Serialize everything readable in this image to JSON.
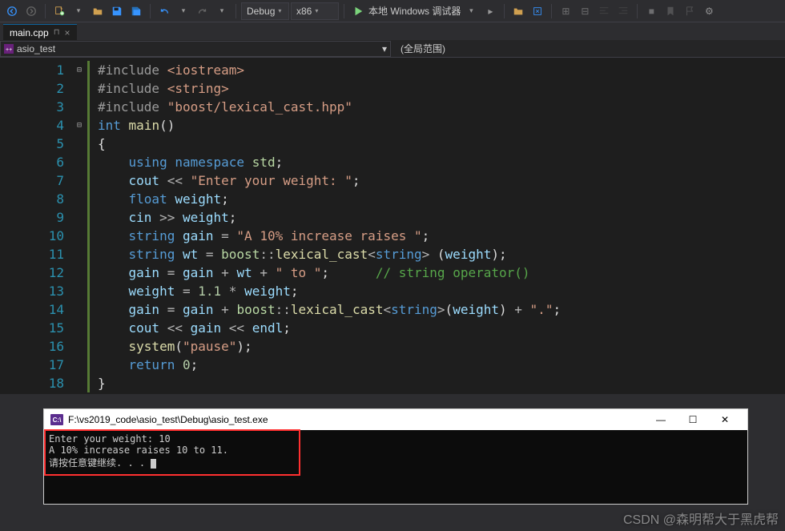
{
  "toolbar": {
    "config": "Debug",
    "platform": "x86",
    "debugger": "本地 Windows 调试器"
  },
  "tab": {
    "name": "main.cpp"
  },
  "context": {
    "project": "asio_test",
    "scope": "(全局范围)"
  },
  "code": {
    "lines": [
      1,
      2,
      3,
      4,
      5,
      6,
      7,
      8,
      9,
      10,
      11,
      12,
      13,
      14,
      15,
      16,
      17,
      18
    ]
  },
  "console": {
    "title": "F:\\vs2019_code\\asio_test\\Debug\\asio_test.exe",
    "line1": "Enter your weight: 10",
    "line2": "A 10% increase raises 10 to 11.",
    "line3": "请按任意键继续. . . "
  },
  "watermark": "CSDN @森明帮大于黑虎帮"
}
